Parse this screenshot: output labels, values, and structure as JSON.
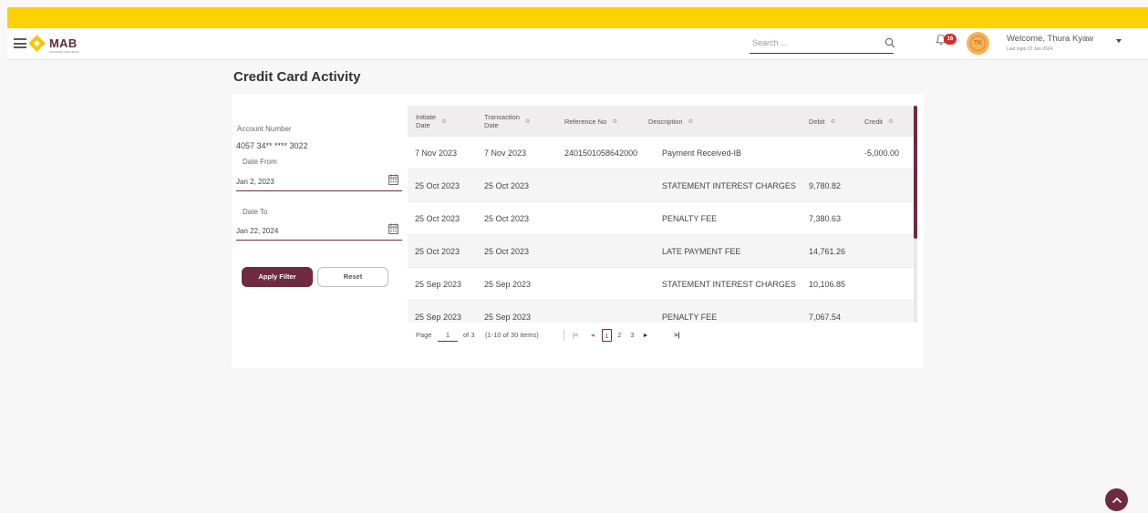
{
  "header": {
    "logo_text": "MAB",
    "logo_tagline": "MYANMAR APEX BANK",
    "search_placeholder": "Search ...",
    "notification_count": "16",
    "avatar_initials": "TK",
    "welcome_text": "Welcome, Thura Kyaw",
    "last_login": "Last login 22 Jan 2024."
  },
  "page": {
    "title": "Credit Card Activity"
  },
  "filter": {
    "account_label": "Account Number",
    "account_value": "4057 34** **** 3022",
    "date_from_label": "Date From",
    "date_from_value": "Jan 2, 2023",
    "date_to_label": "Date To",
    "date_to_value": "Jan 22, 2024",
    "apply_label": "Apply Filter",
    "reset_label": "Reset"
  },
  "table": {
    "columns": [
      {
        "line1": "Initiate",
        "line2": "Date",
        "sort": "≎"
      },
      {
        "line1": "Transaction",
        "line2": "Date",
        "sort": "≎"
      },
      {
        "line1": "Reference No",
        "line2": "",
        "sort": "≎"
      },
      {
        "line1": "Description",
        "line2": "",
        "sort": "≎"
      },
      {
        "line1": "Debit",
        "line2": "",
        "sort": "≎"
      },
      {
        "line1": "Credit",
        "line2": "",
        "sort": "≎"
      }
    ],
    "rows": [
      {
        "initiate": "7 Nov 2023",
        "transaction": "7 Nov 2023",
        "reference": "2401501058642000",
        "description": "Payment Received-IB",
        "debit": "",
        "credit": "-5,000.00"
      },
      {
        "initiate": "25 Oct 2023",
        "transaction": "25 Oct 2023",
        "reference": "",
        "description": "STATEMENT INTEREST CHARGES",
        "debit": "9,780.82",
        "credit": ""
      },
      {
        "initiate": "25 Oct 2023",
        "transaction": "25 Oct 2023",
        "reference": "",
        "description": "PENALTY FEE",
        "debit": "7,380.63",
        "credit": ""
      },
      {
        "initiate": "25 Oct 2023",
        "transaction": "25 Oct 2023",
        "reference": "",
        "description": "LATE PAYMENT FEE",
        "debit": "14,761.26",
        "credit": ""
      },
      {
        "initiate": "25 Sep 2023",
        "transaction": "25 Sep 2023",
        "reference": "",
        "description": "STATEMENT INTEREST CHARGES",
        "debit": "10,106.85",
        "credit": ""
      },
      {
        "initiate": "25 Sep 2023",
        "transaction": "25 Sep 2023",
        "reference": "",
        "description": "PENALTY FEE",
        "debit": "7,067.54",
        "credit": ""
      }
    ]
  },
  "pagination": {
    "page_label": "Page",
    "current_page": "1",
    "of_text": "of 3",
    "items_text": "(1-10 of 30 items)",
    "pages": [
      "1",
      "2",
      "3"
    ],
    "first_icon": "|<",
    "prev_icon": "◂",
    "next_icon": "▸",
    "last_icon": ">|"
  },
  "colors": {
    "brand_yellow": "#fdd000",
    "brand_maroon": "#6e2a3e",
    "badge_red": "#d32f2f"
  },
  "icons": {
    "menu": "hamburger-icon",
    "search": "search-icon",
    "notification": "bell-icon",
    "calendar": "calendar-icon",
    "user_menu": "chevron-down-icon",
    "scroll_top": "chevron-up-icon"
  }
}
